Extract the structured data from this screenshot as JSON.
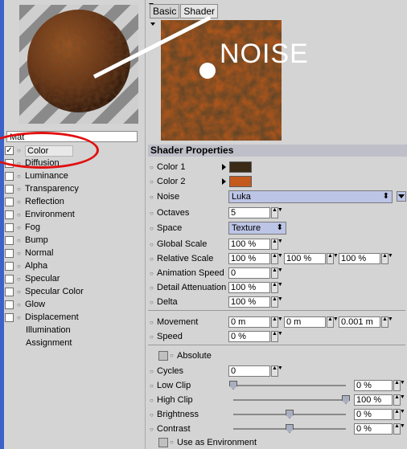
{
  "tabs": [
    "Basic",
    "Shader"
  ],
  "material": {
    "name": "Mat"
  },
  "channels": [
    {
      "label": "Color",
      "checked": true
    },
    {
      "label": "Diffusion",
      "checked": false
    },
    {
      "label": "Luminance",
      "checked": false
    },
    {
      "label": "Transparency",
      "checked": false
    },
    {
      "label": "Reflection",
      "checked": false
    },
    {
      "label": "Environment",
      "checked": false
    },
    {
      "label": "Fog",
      "checked": false
    },
    {
      "label": "Bump",
      "checked": false
    },
    {
      "label": "Normal",
      "checked": false
    },
    {
      "label": "Alpha",
      "checked": false
    },
    {
      "label": "Specular",
      "checked": false
    },
    {
      "label": "Specular Color",
      "checked": false
    },
    {
      "label": "Glow",
      "checked": false
    },
    {
      "label": "Displacement",
      "checked": false
    }
  ],
  "extra_channels": [
    "Illumination",
    "Assignment"
  ],
  "annotation": {
    "text": "NOISE"
  },
  "shader": {
    "title": "Shader Properties",
    "color1": {
      "label": "Color 1",
      "hex": "#3a2a16"
    },
    "color2": {
      "label": "Color 2",
      "hex": "#c45a1e"
    },
    "noise": {
      "label": "Noise",
      "value": "Luka"
    },
    "octaves": {
      "label": "Octaves",
      "value": "5"
    },
    "space": {
      "label": "Space",
      "value": "Texture"
    },
    "global_scale": {
      "label": "Global Scale",
      "value": "100 %"
    },
    "relative_scale": {
      "label": "Relative Scale",
      "values": [
        "100 %",
        "100 %",
        "100 %"
      ]
    },
    "animation_speed": {
      "label": "Animation Speed",
      "value": "0"
    },
    "detail_attenuation": {
      "label": "Detail Attenuation",
      "value": "100 %"
    },
    "delta": {
      "label": "Delta",
      "value": "100 %"
    },
    "movement": {
      "label": "Movement",
      "values": [
        "0 m",
        "0 m",
        "0.001 m"
      ]
    },
    "speed": {
      "label": "Speed",
      "value": "0 %"
    },
    "absolute": {
      "label": "Absolute",
      "checked": false
    },
    "cycles": {
      "label": "Cycles",
      "value": "0"
    },
    "low_clip": {
      "label": "Low Clip",
      "value": "0 %",
      "level": 0.0
    },
    "high_clip": {
      "label": "High Clip",
      "value": "100 %",
      "level": 1.0
    },
    "brightness": {
      "label": "Brightness",
      "value": "0 %",
      "level": 0.5
    },
    "contrast": {
      "label": "Contrast",
      "value": "0 %",
      "level": 0.5
    },
    "use_as_env": {
      "label": "Use as Environment",
      "checked": false
    }
  },
  "colors": {
    "accent_strip": "#3a62c8",
    "section_header": "#bfbfc9",
    "dropdown": "#bcc5e6",
    "callout": "#e01010"
  }
}
